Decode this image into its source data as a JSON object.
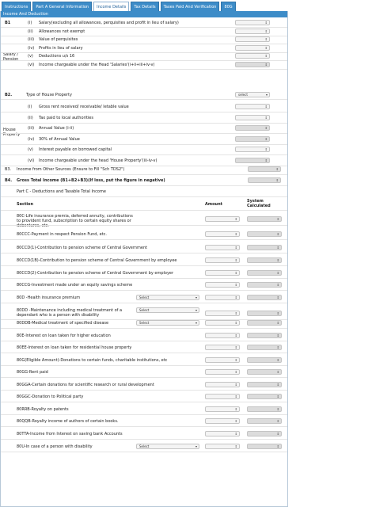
{
  "tabs": [
    {
      "label": "Instructions",
      "active": false
    },
    {
      "label": "Part A General Information",
      "active": false
    },
    {
      "label": "Income Details",
      "active": true
    },
    {
      "label": "Tax Details",
      "active": false
    },
    {
      "label": "Taxes Paid And Verification",
      "active": false
    },
    {
      "label": "80G",
      "active": false
    }
  ],
  "section_header": "Income And Deduction",
  "b1": {
    "code": "B1",
    "group_label": "Salary / Pension",
    "items": [
      {
        "num": "(i)",
        "label": "Salary(excluding all allowances, perquisites and profit in lieu of salary)"
      },
      {
        "num": "(ii)",
        "label": "Allowances not exempt"
      },
      {
        "num": "(iii)",
        "label": "Value of perquisites"
      },
      {
        "num": "(iv)",
        "label": "Profits in lieu of salary"
      },
      {
        "num": "(v)",
        "label": "Deductions u/s 16"
      },
      {
        "num": "(vi)",
        "label": "Income chargeable under the Head 'Salaries'(i+ii+iii+iv-v)"
      }
    ]
  },
  "b2": {
    "code": "B2.",
    "label": "Type of House Property",
    "select_value": "select",
    "group_label": "House Property",
    "items": [
      {
        "num": "(i)",
        "label": "Gross rent received/ receivable/ letable value"
      },
      {
        "num": "(ii)",
        "label": "Tax paid to local authorities"
      },
      {
        "num": "(iii)",
        "label": "Annual Value (i-ii)"
      },
      {
        "num": "(iv)",
        "label": "30% of Annual Value"
      },
      {
        "num": "(v)",
        "label": "Interest payable on borrowed capital"
      },
      {
        "num": "(vi)",
        "label": "Income chargeable under the head 'House Property'(iii-iv-v)"
      }
    ]
  },
  "b3": {
    "code": "B3.",
    "label": "Income from Other Sources (Ensure to Fill \"Sch TDS2\")"
  },
  "b4": {
    "code": "B4.",
    "label": "Gross Total Income (B1+B2+B3)(If loss, put the figure in negative)"
  },
  "part_c_title": "Part C - Deductions and Taxable Total Income",
  "table_headers": {
    "section": "Section",
    "amount": "Amount",
    "system": "System Calculated"
  },
  "deductions": [
    {
      "label": "80C-Life insurance premia, deferred annuity, contributions to provident fund, subscription to certain equity shares or debentures, etc.",
      "select": ""
    },
    {
      "label": "80CCC-Payment in respect Pension Fund, etc.",
      "select": ""
    },
    {
      "label": "80CCD(1)-Contribution to pension scheme of Central Government",
      "select": ""
    },
    {
      "label": "80CCD(1B)-Contribution to pension scheme of Central Government by employee",
      "select": ""
    },
    {
      "label": "80CCD(2)-Contribution to pension scheme of Central Government by employer",
      "select": ""
    },
    {
      "label": "80CCG-Investment made under an equity savings scheme",
      "select": ""
    },
    {
      "label": "80D -Health insurance premium",
      "select": "Select"
    },
    {
      "label": "80DD -Maintenance including medical treatment of a dependant who is a person with disability",
      "select": "Select"
    },
    {
      "label": "80DDB-Medical treatment of specified disease",
      "select": "Select"
    },
    {
      "label": "80E-Interest on loan taken for higher education",
      "select": ""
    },
    {
      "label": "80EE-Interest on loan taken for residential house property",
      "select": ""
    },
    {
      "label": "80G(Eligible Amount)-Donations to certain funds, charitable institutions, etc",
      "select": ""
    },
    {
      "label": "80GG-Rent paid",
      "select": ""
    },
    {
      "label": "80GGA-Certain donations for scientific research or rural development",
      "select": ""
    },
    {
      "label": "80GGC-Donation to Political party",
      "select": ""
    },
    {
      "label": "80RRB-Royalty on patents",
      "select": ""
    },
    {
      "label": "80QQB-Royalty income of authors of certain books.",
      "select": ""
    },
    {
      "label": "80TTA-Income from Interest on saving bank Accounts",
      "select": ""
    },
    {
      "label": "80U-In case of a person with disability",
      "select": "Select"
    }
  ],
  "spinner_icon": "spinner-arrows-icon",
  "dropdown_icon": "chevron-down-icon"
}
